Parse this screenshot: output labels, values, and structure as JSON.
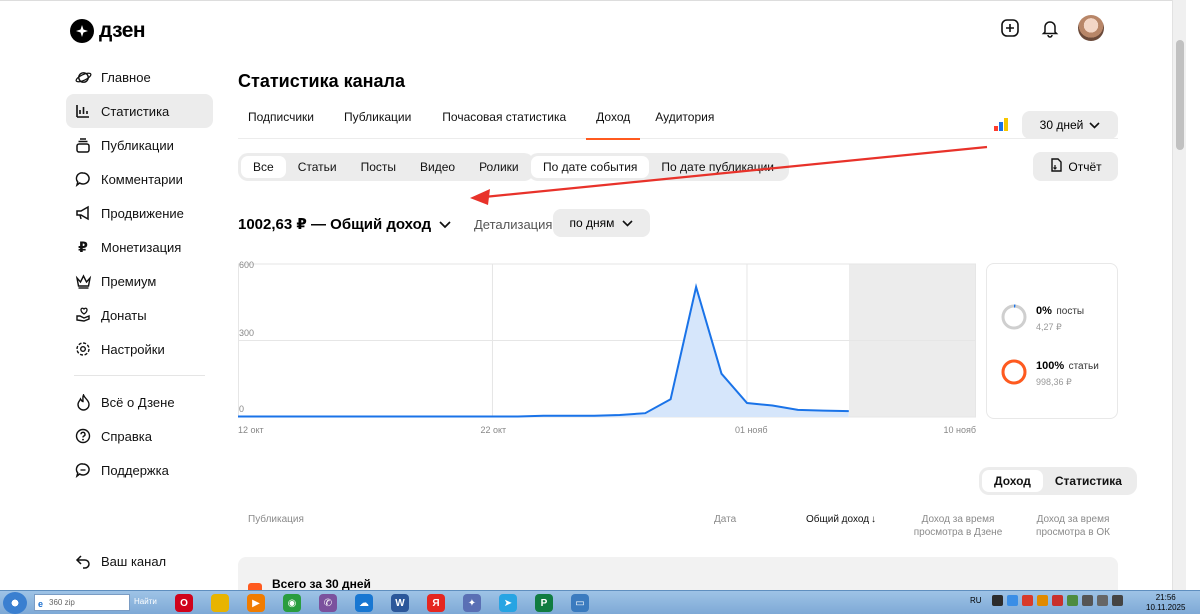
{
  "app": {
    "logo_text": "дзен"
  },
  "header": {
    "add_icon": "plus-circle-icon",
    "bell_icon": "bell-icon"
  },
  "sidebar": {
    "items": [
      {
        "label": "Главное",
        "icon": "planet-icon"
      },
      {
        "label": "Статистика",
        "icon": "chart-icon",
        "active": true
      },
      {
        "label": "Публикации",
        "icon": "layers-icon"
      },
      {
        "label": "Комментарии",
        "icon": "comment-icon"
      },
      {
        "label": "Продвижение",
        "icon": "megaphone-icon"
      },
      {
        "label": "Монетизация",
        "icon": "ruble-icon"
      },
      {
        "label": "Премиум",
        "icon": "crown-icon"
      },
      {
        "label": "Донаты",
        "icon": "donate-icon"
      },
      {
        "label": "Настройки",
        "icon": "gear-icon"
      }
    ],
    "secondary": [
      {
        "label": "Всё о Дзене",
        "icon": "flame-icon"
      },
      {
        "label": "Справка",
        "icon": "help-icon"
      },
      {
        "label": "Поддержка",
        "icon": "support-icon"
      }
    ],
    "channel": {
      "label": "Ваш канал",
      "icon": "back-arrow-icon"
    }
  },
  "page": {
    "title": "Статистика канала",
    "tabs": [
      "Подписчики",
      "Публикации",
      "Почасовая статистика",
      "Доход",
      "Аудитория"
    ],
    "active_tab": "Доход",
    "period": "30 дней",
    "content_filter": [
      "Все",
      "Статьи",
      "Посты",
      "Видео",
      "Ролики"
    ],
    "date_filter": [
      "По дате события",
      "По дате публикации"
    ],
    "report_label": "Отчёт",
    "total_label": "1002,63 ₽ — Общий доход",
    "detail_label": "Детализация",
    "detail_value": "по дням"
  },
  "chart_data": {
    "type": "area",
    "x_tick_labels": [
      "12 окт",
      "22 окт",
      "01 нояб",
      "10 нояб"
    ],
    "y_tick_labels": [
      "600",
      "300",
      "0"
    ],
    "ylim": [
      0,
      600
    ],
    "x": [
      "12 окт",
      "13 окт",
      "14 окт",
      "15 окт",
      "16 окт",
      "17 окт",
      "18 окт",
      "19 окт",
      "20 окт",
      "21 окт",
      "22 окт",
      "23 окт",
      "24 окт",
      "25 окт",
      "26 окт",
      "27 окт",
      "28 окт",
      "29 окт",
      "30 окт",
      "31 окт",
      "01 нояб",
      "02 нояб",
      "03 нояб",
      "04 нояб",
      "05 нояб"
    ],
    "values": [
      2,
      2,
      2,
      2,
      2,
      2,
      2,
      2,
      2,
      2,
      2,
      2,
      5,
      5,
      5,
      8,
      15,
      70,
      510,
      170,
      55,
      45,
      28,
      25,
      23
    ],
    "series_color": "#1a73e8",
    "fill_color": "#d6e6fb",
    "grid": true
  },
  "breakdown": [
    {
      "pct": "0%",
      "name": "посты",
      "amount": "4,27 ₽",
      "fraction": 0.004,
      "color": "#1a73e8"
    },
    {
      "pct": "100%",
      "name": "статьи",
      "amount": "998,36 ₽",
      "fraction": 0.996,
      "color": "#ff5a1f"
    }
  ],
  "table": {
    "toggle": [
      "Доход",
      "Статистика"
    ],
    "headers": {
      "publication": "Публикация",
      "date": "Дата",
      "total": "Общий доход",
      "zen_time": "Доход за время просмотра в Дзене",
      "ok_time": "Доход за время просмотра в ОК"
    },
    "total_row_label": "Всего за 30 дней"
  },
  "taskbar": {
    "search_text": "360 zip",
    "find_label": "Найти",
    "lang": "RU",
    "time": "21:56",
    "date": "10.11.2025",
    "apps": [
      {
        "name": "opera-icon",
        "color": "#d0021b",
        "glyph": "O"
      },
      {
        "name": "folder-icon",
        "color": "#e8b400",
        "glyph": ""
      },
      {
        "name": "media-icon",
        "color": "#f07c00",
        "glyph": "▶"
      },
      {
        "name": "chrome-icon",
        "color": "#2a9d3f",
        "glyph": "◉"
      },
      {
        "name": "viber-icon",
        "color": "#7b519d",
        "glyph": "✆"
      },
      {
        "name": "cloud-icon",
        "color": "#1877d2",
        "glyph": "☁"
      },
      {
        "name": "word-icon",
        "color": "#2b579a",
        "glyph": "W"
      },
      {
        "name": "yandex-icon",
        "color": "#e52620",
        "glyph": "Я"
      },
      {
        "name": "bot-icon",
        "color": "#5a6fb4",
        "glyph": "✦"
      },
      {
        "name": "telegram-icon",
        "color": "#27a4e3",
        "glyph": "➤"
      },
      {
        "name": "publisher-icon",
        "color": "#107c41",
        "glyph": "P"
      },
      {
        "name": "picture-icon",
        "color": "#3b7bbf",
        "glyph": "▭"
      }
    ]
  }
}
